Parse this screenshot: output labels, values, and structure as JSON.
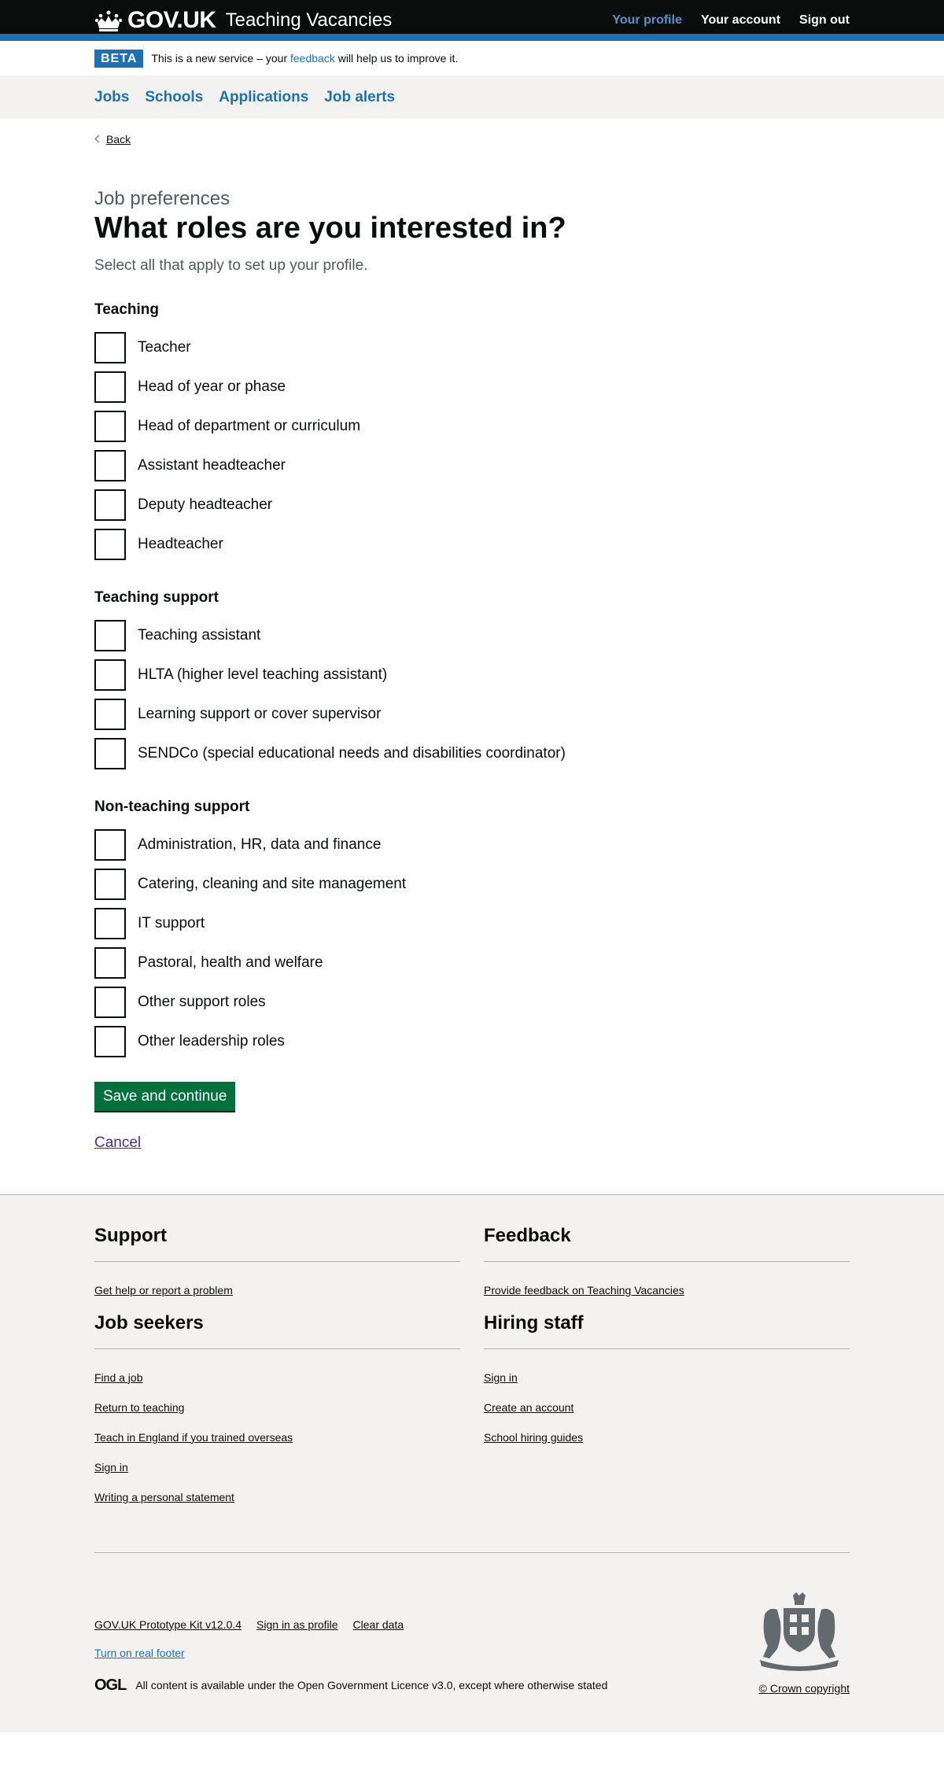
{
  "header": {
    "logo_text": "GOV.UK",
    "service_name": "Teaching Vacancies",
    "nav": [
      {
        "label": "Your profile",
        "active": true
      },
      {
        "label": "Your account",
        "active": false
      },
      {
        "label": "Sign out",
        "active": false
      }
    ]
  },
  "beta": {
    "tag": "BETA",
    "text_before": "This is a new service – your ",
    "link": "feedback",
    "text_after": " will help us to improve it."
  },
  "nav": [
    "Jobs",
    "Schools",
    "Applications",
    "Job alerts"
  ],
  "main": {
    "back": "Back",
    "caption": "Job preferences",
    "title": "What roles are you interested in?",
    "hint": "Select all that apply to set up your profile.",
    "groups": [
      {
        "title": "Teaching",
        "options": [
          "Teacher",
          "Head of year or phase",
          "Head of department or curriculum",
          "Assistant headteacher",
          "Deputy headteacher",
          "Headteacher"
        ]
      },
      {
        "title": "Teaching support",
        "options": [
          "Teaching assistant",
          "HLTA (higher level teaching assistant)",
          "Learning support or cover supervisor",
          "SENDCo (special educational needs and disabilities coordinator)"
        ]
      },
      {
        "title": "Non-teaching support",
        "options": [
          "Administration, HR, data and finance",
          "Catering, cleaning and site management",
          "IT support",
          "Pastoral, health and welfare",
          "Other support roles",
          "Other leadership roles"
        ]
      }
    ],
    "submit": "Save and continue",
    "cancel": "Cancel"
  },
  "footer": {
    "support": {
      "title": "Support",
      "links": [
        "Get help or report a problem"
      ]
    },
    "feedback": {
      "title": "Feedback",
      "links": [
        "Provide feedback on Teaching Vacancies"
      ]
    },
    "job_seekers": {
      "title": "Job seekers",
      "links": [
        "Find a job",
        "Return to teaching",
        "Teach in England if you trained overseas",
        "Sign in",
        "Writing a personal statement"
      ]
    },
    "hiring_staff": {
      "title": "Hiring staff",
      "links": [
        "Sign in",
        "Create an account",
        "School hiring guides"
      ]
    },
    "meta_links": [
      "GOV.UK Prototype Kit v12.0.4",
      "Sign in as profile",
      "Clear data"
    ],
    "real_footer": "Turn on real footer",
    "ogl": "OGL",
    "licence_before": "All content is available under the ",
    "licence_link": "Open Government Licence v3.0",
    "licence_after": ", except where otherwise stated",
    "copyright": "© Crown copyright"
  }
}
